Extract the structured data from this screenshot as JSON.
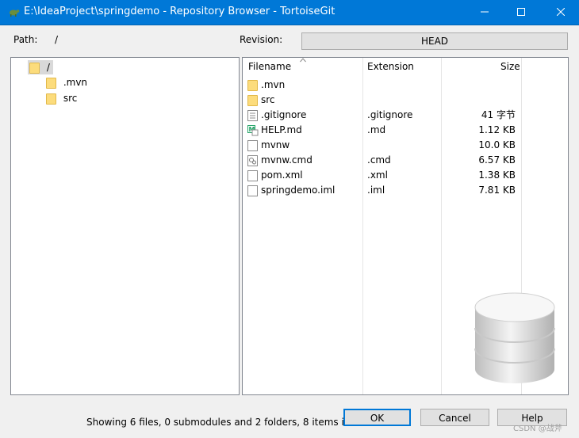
{
  "window": {
    "title": "E:\\IdeaProject\\springdemo - Repository Browser - TortoiseGit"
  },
  "path": {
    "label": "Path:",
    "value": "/"
  },
  "revision": {
    "label": "Revision:",
    "value": "HEAD"
  },
  "tree": {
    "root": "/",
    "children": [
      ".mvn",
      "src"
    ]
  },
  "list": {
    "headers": {
      "filename": "Filename",
      "extension": "Extension",
      "size": "Size"
    },
    "rows": [
      {
        "name": ".mvn",
        "ext": "",
        "size": "",
        "icon": "folder-icon"
      },
      {
        "name": "src",
        "ext": "",
        "size": "",
        "icon": "folder-icon"
      },
      {
        "name": ".gitignore",
        "ext": ".gitignore",
        "size": "41 字节",
        "icon": "text-file-icon"
      },
      {
        "name": "HELP.md",
        "ext": ".md",
        "size": "1.12 KB",
        "icon": "markdown-file-icon"
      },
      {
        "name": "mvnw",
        "ext": "",
        "size": "10.0 KB",
        "icon": "file-icon"
      },
      {
        "name": "mvnw.cmd",
        "ext": ".cmd",
        "size": "6.57 KB",
        "icon": "cmd-file-icon"
      },
      {
        "name": "pom.xml",
        "ext": ".xml",
        "size": "1.38 KB",
        "icon": "file-icon"
      },
      {
        "name": "springdemo.iml",
        "ext": ".iml",
        "size": "7.81 KB",
        "icon": "file-icon"
      }
    ]
  },
  "status": "Showing 6 files, 0 submodules and 2 folders, 8 items in total",
  "buttons": {
    "ok": "OK",
    "cancel": "Cancel",
    "help": "Help"
  },
  "watermark": "CSDN @战斧"
}
